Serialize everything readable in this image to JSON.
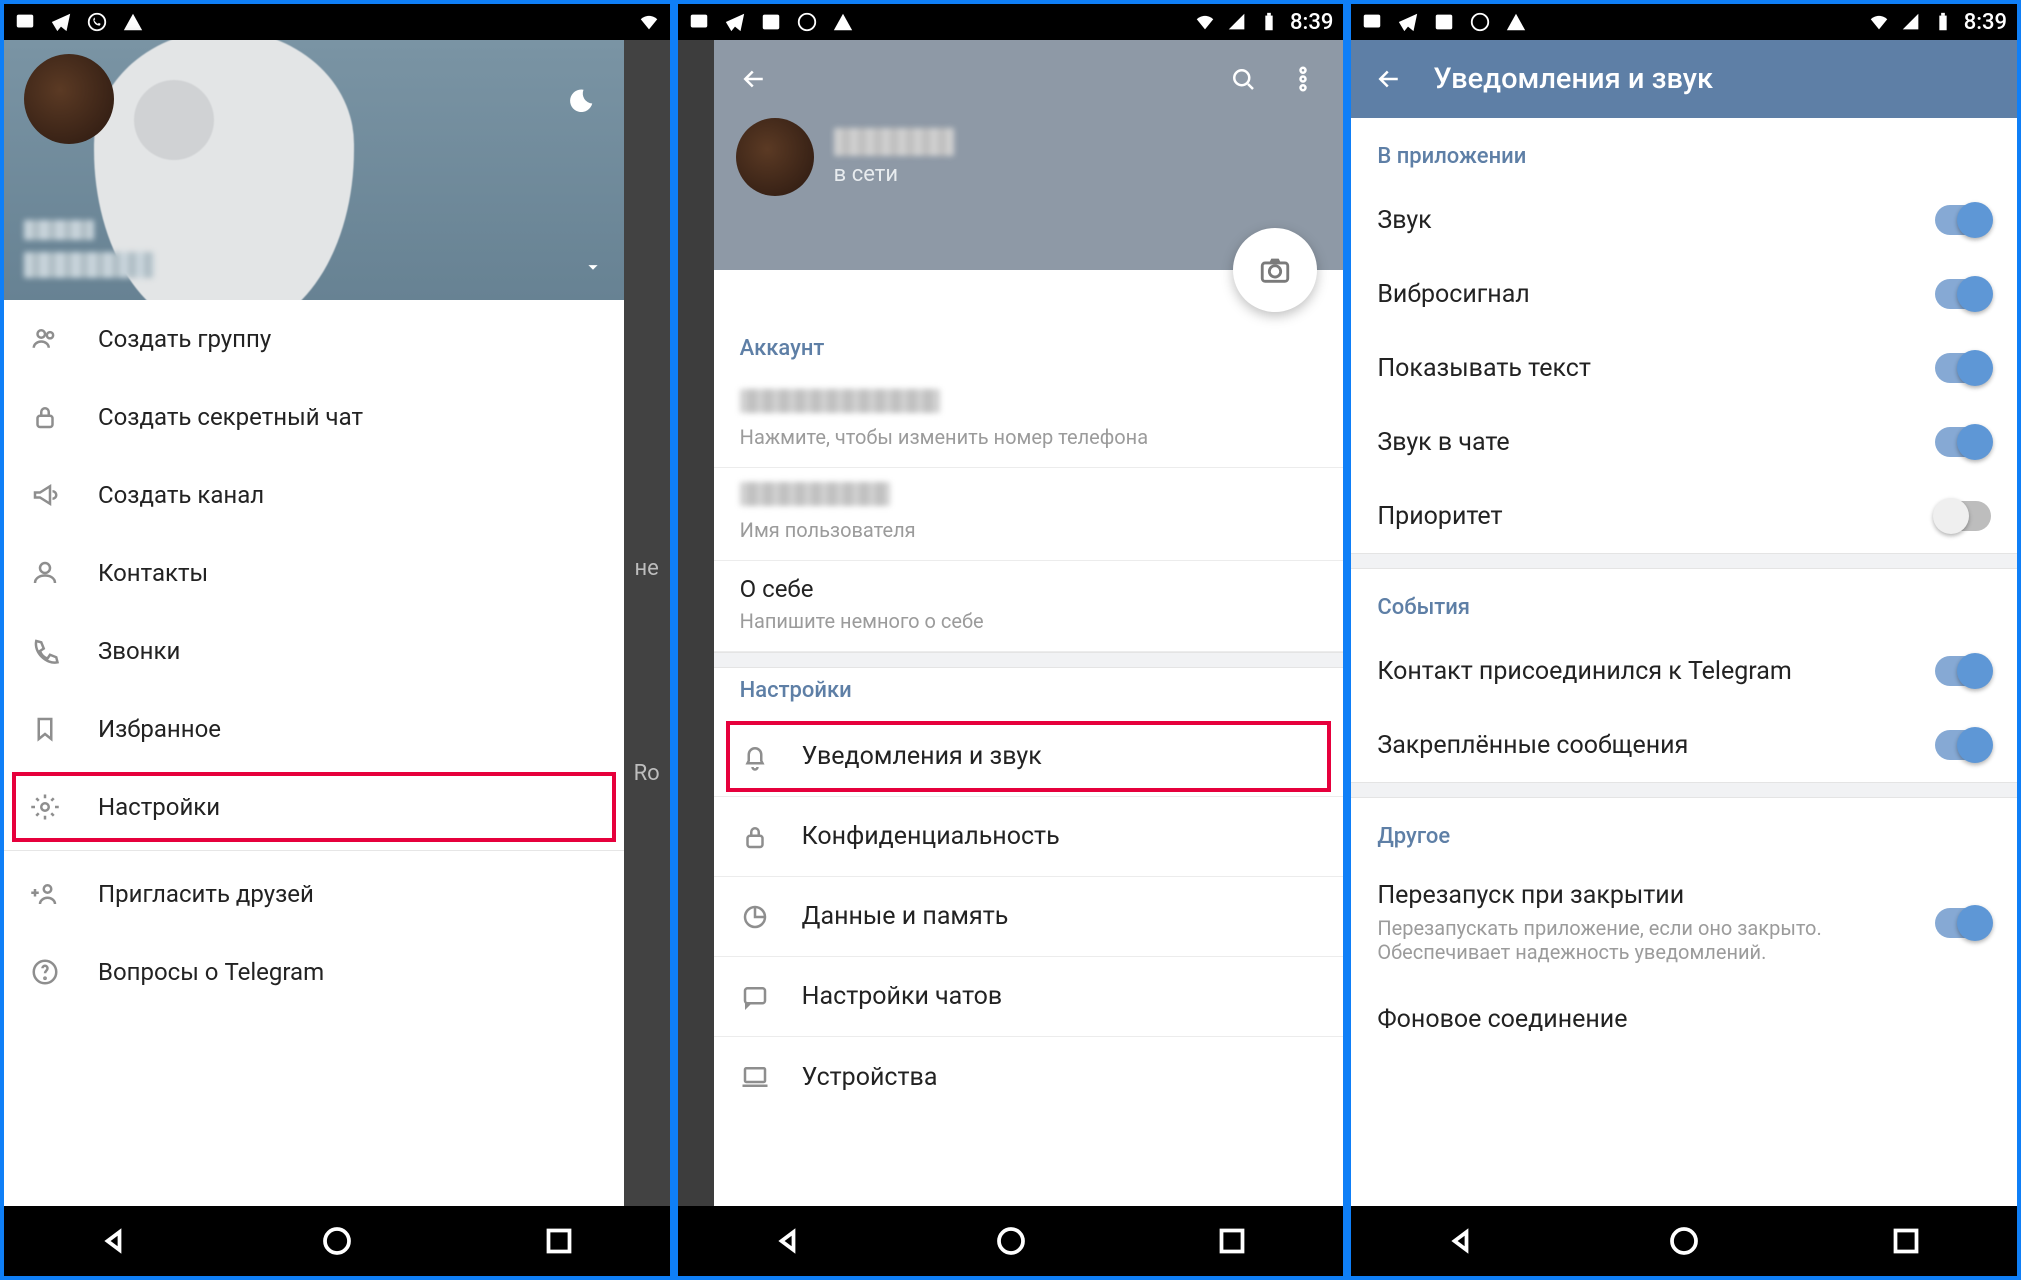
{
  "status": {
    "time": "8:39"
  },
  "screen1": {
    "drawer": {
      "items": [
        {
          "icon": "group-icon",
          "label": "Создать группу"
        },
        {
          "icon": "lock-icon",
          "label": "Создать секретный чат"
        },
        {
          "icon": "megaphone-icon",
          "label": "Создать канал"
        },
        {
          "icon": "person-icon",
          "label": "Контакты"
        },
        {
          "icon": "phone-icon",
          "label": "Звонки"
        },
        {
          "icon": "bookmark-icon",
          "label": "Избранное"
        },
        {
          "icon": "gear-icon",
          "label": "Настройки",
          "highlight": true
        }
      ],
      "footer": [
        {
          "icon": "invite-icon",
          "label": "Пригласить друзей"
        },
        {
          "icon": "help-icon",
          "label": "Вопросы о Telegram"
        }
      ]
    },
    "bg_hints": [
      "не",
      "Ro"
    ]
  },
  "screen2": {
    "profile_status": "в сети",
    "account": {
      "title": "Аккаунт",
      "phone_sub": "Нажмите, чтобы изменить номер телефона",
      "username_sub": "Имя пользователя",
      "bio_title": "О себе",
      "bio_sub": "Напишите немного о себе"
    },
    "settings_title": "Настройки",
    "settings_items": [
      {
        "icon": "bell-icon",
        "label": "Уведомления и звук",
        "highlight": true
      },
      {
        "icon": "lock-icon",
        "label": "Конфиденциальность"
      },
      {
        "icon": "pie-icon",
        "label": "Данные и память"
      },
      {
        "icon": "chat-icon",
        "label": "Настройки чатов"
      },
      {
        "icon": "laptop-icon",
        "label": "Устройства"
      }
    ]
  },
  "screen3": {
    "title": "Уведомления и звук",
    "sections": [
      {
        "title": "В приложении",
        "rows": [
          {
            "label": "Звук",
            "on": true
          },
          {
            "label": "Вибросигнал",
            "on": true
          },
          {
            "label": "Показывать текст",
            "on": true
          },
          {
            "label": "Звук в чате",
            "on": true
          },
          {
            "label": "Приоритет",
            "on": false
          }
        ]
      },
      {
        "title": "События",
        "rows": [
          {
            "label": "Контакт присоединился к Telegram",
            "on": true
          },
          {
            "label": "Закреплённые сообщения",
            "on": true
          }
        ]
      },
      {
        "title": "Другое",
        "rows": [
          {
            "label": "Перезапуск при закрытии",
            "sub": "Перезапускать приложение, если оно закрыто. Обеспечивает надежность уведомлений.",
            "on": true
          },
          {
            "label": "Фоновое соединение"
          }
        ]
      }
    ]
  }
}
